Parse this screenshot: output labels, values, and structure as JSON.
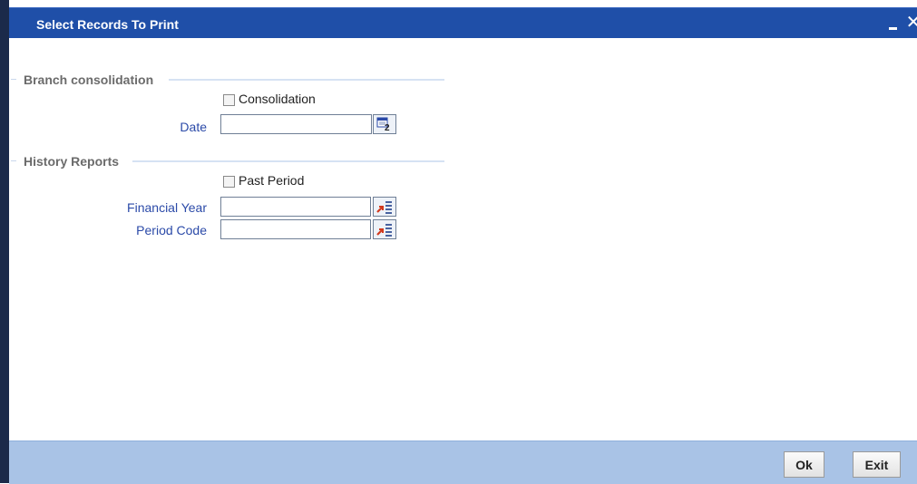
{
  "window": {
    "title": "Select Records To Print",
    "minimize_icon": "minimize-icon",
    "close_icon": "close-icon",
    "close_glyph": "✕"
  },
  "branch_consolidation": {
    "section_title": "Branch consolidation",
    "consolidation_checkbox_label": "Consolidation",
    "consolidation_checked": false,
    "date_label": "Date",
    "date_value": "",
    "date_picker_icon": "calendar-icon"
  },
  "history_reports": {
    "section_title": "History Reports",
    "past_period_checkbox_label": "Past Period",
    "past_period_checked": false,
    "financial_year_label": "Financial Year",
    "financial_year_value": "",
    "period_code_label": "Period Code",
    "period_code_value": "",
    "lov_icon": "list-of-values-icon"
  },
  "footer": {
    "ok_label": "Ok",
    "exit_label": "Exit"
  },
  "colors": {
    "title_bar": "#1f4fa8",
    "footer": "#a9c3e6",
    "label_blue": "#2b4aa8",
    "section_gray": "#6b6b6b"
  }
}
